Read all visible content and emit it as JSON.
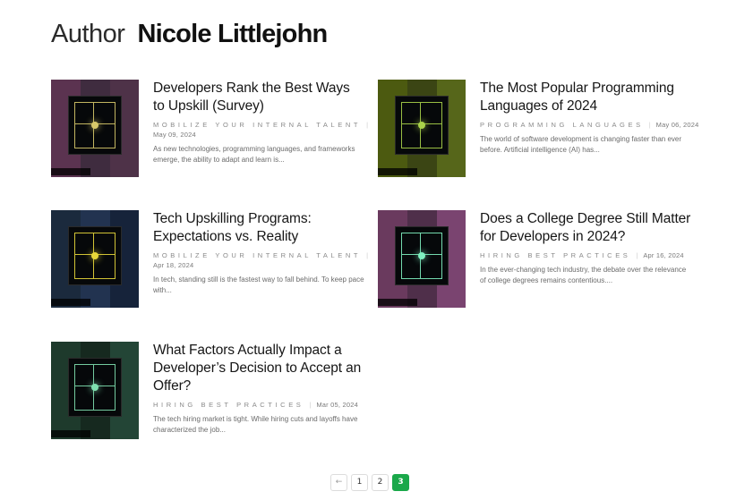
{
  "header": {
    "label": "Author",
    "name": "Nicole Littlejohn"
  },
  "posts": [
    {
      "title": "Developers Rank the Best Ways to Upskill (Survey)",
      "category": "Mobilize Your Internal Talent",
      "date": "May 09, 2024",
      "excerpt": "As new technologies, programming languages, and frameworks emerge, the ability to adapt and learn is...",
      "thumb_colors": [
        "#5b3350",
        "#3f2c3f",
        "#4e3248",
        "#6a3a5a"
      ],
      "accent": "#d7c86a"
    },
    {
      "title": "The Most Popular Programming Languages of 2024",
      "category": "Programming Languages",
      "date": "May 06, 2024",
      "excerpt": "The world of software development is changing faster than ever before. Artificial intelligence (AI) has...",
      "thumb_colors": [
        "#4c5a10",
        "#3b4514",
        "#56661a",
        "#2f3512"
      ],
      "accent": "#a9d24a"
    },
    {
      "title": "Tech Upskilling Programs: Expectations vs. Reality",
      "category": "Mobilize Your Internal Talent",
      "date": "Apr 18, 2024",
      "excerpt": "In tech, standing still is the fastest way to fall behind. To keep pace with...",
      "thumb_colors": [
        "#1b2a3d",
        "#223350",
        "#16233a",
        "#2a3b56"
      ],
      "accent": "#e8d83a"
    },
    {
      "title": "Does a College Degree Still Matter for Developers in 2024?",
      "category": "Hiring Best Practices",
      "date": "Apr 16, 2024",
      "excerpt": "In the ever-changing tech industry, the debate over the relevance of college degrees remains contentious....",
      "thumb_colors": [
        "#6a3a5e",
        "#4f2f4a",
        "#7a4470",
        "#3f2a40"
      ],
      "accent": "#7ff0c0"
    },
    {
      "title": "What Factors Actually Impact a Developer’s Decision to Accept an Offer?",
      "category": "Hiring Best Practices",
      "date": "Mar 05, 2024",
      "excerpt": "The tech hiring market is tight. While hiring cuts and layoffs have characterized the job...",
      "thumb_colors": [
        "#1e3a2c",
        "#16291f",
        "#234536",
        "#0f1f17"
      ],
      "accent": "#7fe0b0"
    }
  ],
  "pagination": {
    "prev": "←",
    "pages": [
      "1",
      "2",
      "3"
    ],
    "current": "3"
  }
}
